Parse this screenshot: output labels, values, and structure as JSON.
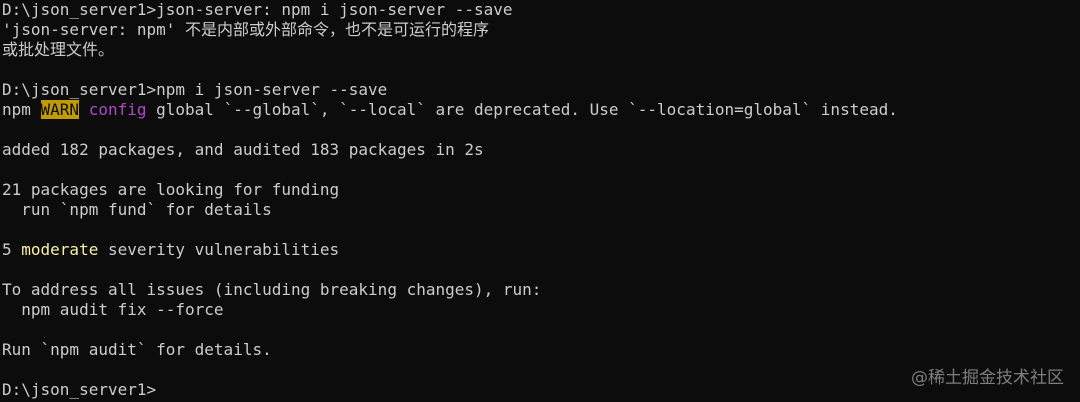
{
  "terminal": {
    "line1": "D:\\json_server1>json-server: npm i json-server --save",
    "line2": "'json-server: npm' 不是内部或外部命令，也不是可运行的程序",
    "line3": "或批处理文件。",
    "line4": "",
    "line5": "D:\\json_server1>npm i json-server --save",
    "line6": {
      "prefix": "npm ",
      "warn": "WARN",
      "space": " ",
      "config": "config",
      "rest": " global `--global`, `--local` are deprecated. Use `--location=global` instead."
    },
    "line7": "",
    "line8": "added 182 packages, and audited 183 packages in 2s",
    "line9": "",
    "line10": "21 packages are looking for funding",
    "line11": "  run `npm fund` for details",
    "line12": "",
    "line13": {
      "count": "5 ",
      "level": "moderate",
      "rest": " severity vulnerabilities"
    },
    "line14": "",
    "line15": "To address all issues (including breaking changes), run:",
    "line16": "  npm audit fix --force",
    "line17": "",
    "line18": "Run `npm audit` for details.",
    "line19": "",
    "line20": "D:\\json_server1>"
  },
  "watermark": "@稀土掘金技术社区",
  "colors": {
    "background": "#0c0c0c",
    "foreground": "#cccccc",
    "warn_bg": "#c19c00",
    "config": "#b148c6",
    "moderate": "#f9f1a5"
  }
}
